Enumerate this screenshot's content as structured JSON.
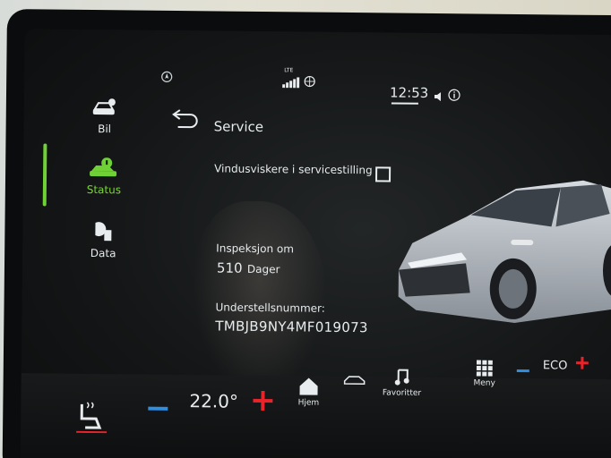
{
  "status": {
    "network": "LTE",
    "time": "12:53"
  },
  "sidebar": {
    "items": [
      {
        "label": "Bil",
        "icon": "car-settings-icon"
      },
      {
        "label": "Status",
        "icon": "car-info-icon",
        "active": true
      },
      {
        "label": "Data",
        "icon": "data-fuel-icon"
      }
    ]
  },
  "header": {
    "back_icon": "back-arrow-icon",
    "title": "Service"
  },
  "main": {
    "wiper_label": "Vindusviskere i servicestilling",
    "wiper_checked": false,
    "inspection_label": "Inspeksjon om",
    "inspection_value": "510",
    "inspection_unit": "Dager",
    "vin_label": "Understellsnummer:",
    "vin_value": "TMBJB9NY4MF019073"
  },
  "bottom": {
    "temperature": "22.0°",
    "home_label": "Hjem",
    "favorites_label": "Favoritter",
    "menu_label": "Meny",
    "mode_label": "ECO"
  },
  "colors": {
    "accent_green": "#6fd136",
    "temp_minus": "#2f8ee0",
    "temp_plus": "#e8242a"
  }
}
